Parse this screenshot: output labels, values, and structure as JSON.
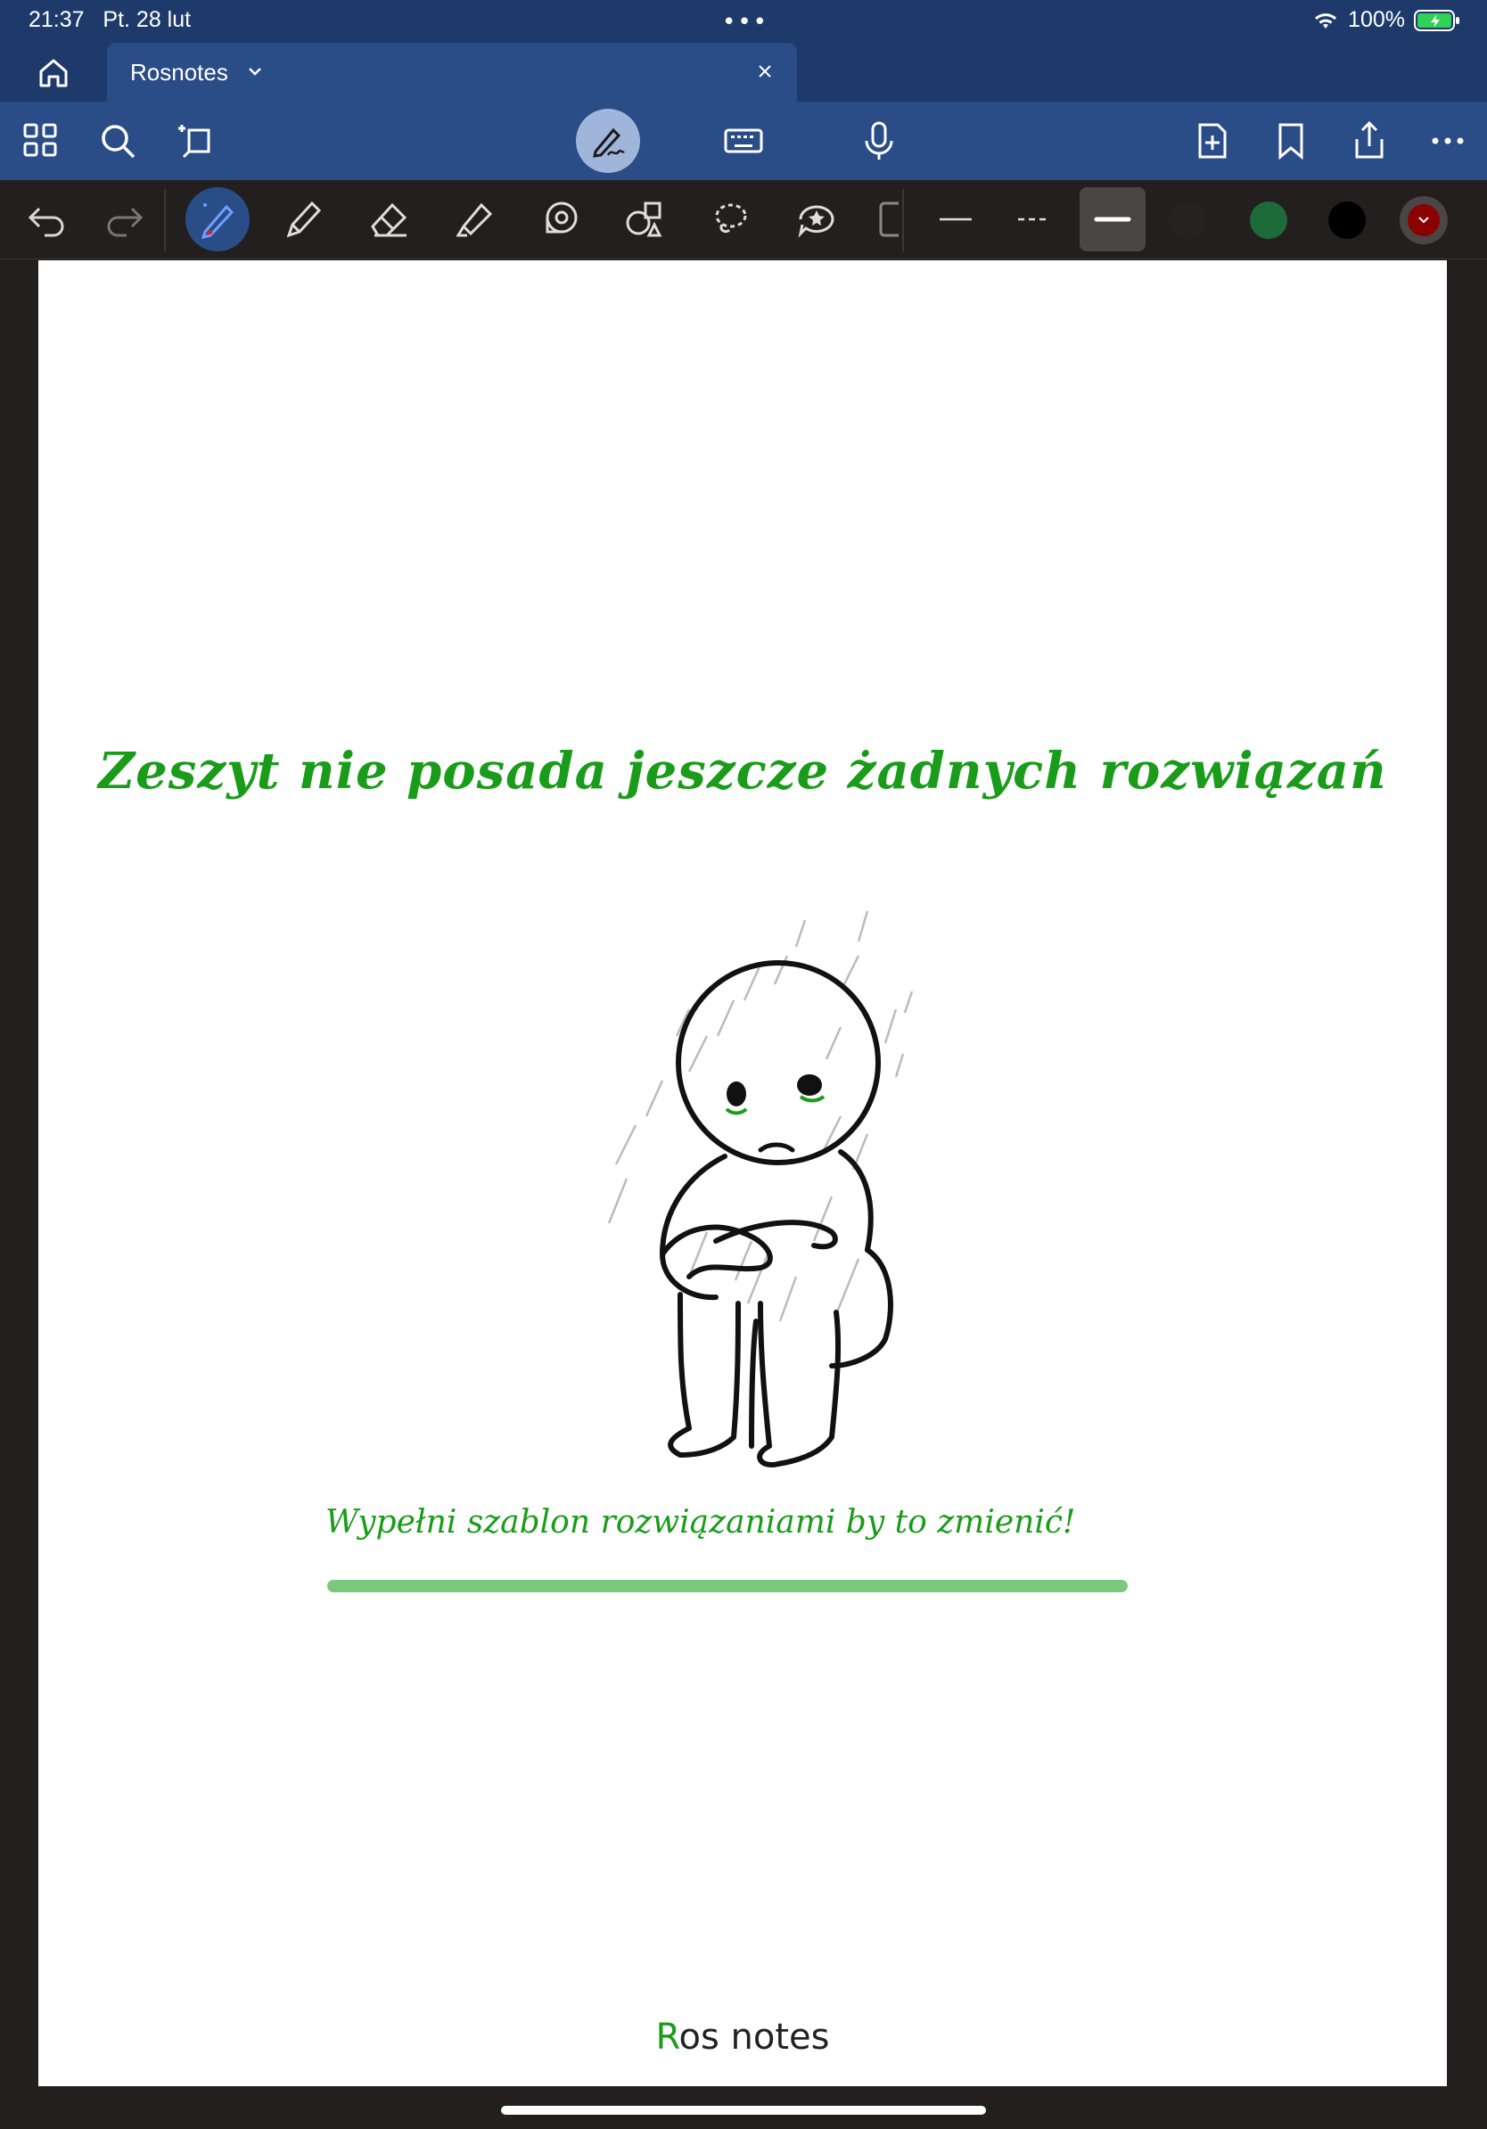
{
  "status_bar": {
    "time": "21:37",
    "date": "Pt. 28 lut",
    "battery": "100%"
  },
  "tab": {
    "title": "Rosnotes"
  },
  "colors": {
    "accent_green": "#1a9c1a",
    "nav_blue": "#1e3a6b",
    "toolbar_blue": "#2a4c87",
    "swatch_green": "#1e6b3a",
    "swatch_black": "#000000",
    "swatch_red": "#8b0000"
  },
  "toolbar_top": {
    "left": [
      "grid-icon",
      "search-icon",
      "lasso-select-icon"
    ],
    "center": [
      "handwriting-icon",
      "keyboard-icon",
      "microphone-icon"
    ],
    "right": [
      "add-page-icon",
      "bookmark-icon",
      "share-icon",
      "more-icon"
    ]
  },
  "toolbar_tools": [
    "undo-icon",
    "redo-icon",
    "pen-icon",
    "pencil-icon",
    "eraser-icon",
    "highlighter-icon",
    "tape-icon",
    "shapes-icon",
    "lasso-icon",
    "sticker-icon",
    "image-icon"
  ],
  "page": {
    "headline": "Zeszyt  nie posada jeszcze żadnych rozwiązań",
    "subline": "Wypełni szablon rozwiązaniami by to zmienić!",
    "brand_first": "R",
    "brand_rest": "os notes",
    "progress": 1.0
  }
}
